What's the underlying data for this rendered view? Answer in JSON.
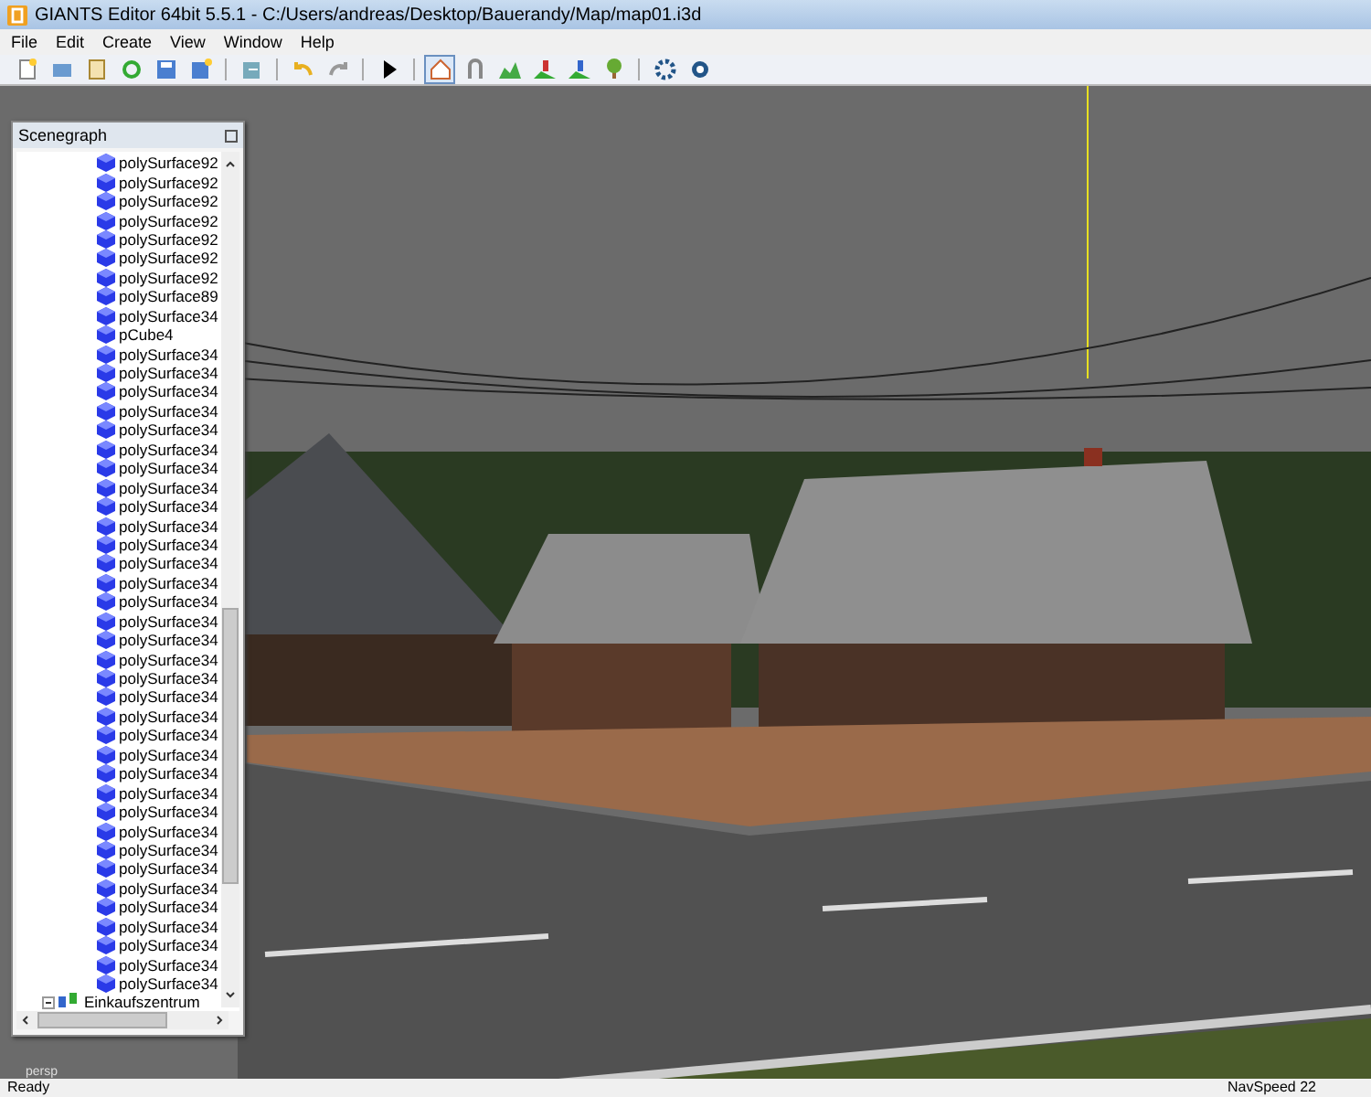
{
  "window": {
    "title": "GIANTS Editor 64bit 5.5.1 - C:/Users/andreas/Desktop/Bauerandy/Map/map01.i3d"
  },
  "menu": [
    "File",
    "Edit",
    "Create",
    "View",
    "Window",
    "Help"
  ],
  "toolbar": [
    {
      "selected": false
    },
    {
      "selected": false
    },
    {
      "selected": false
    },
    {
      "selected": false
    },
    {
      "selected": false
    },
    {
      "selected": false
    },
    {
      "selected": false
    },
    {
      "selected": false
    },
    {
      "selected": false
    },
    {
      "selected": false
    },
    {
      "selected": true
    },
    {
      "selected": false
    },
    {
      "selected": false
    },
    {
      "selected": false
    },
    {
      "selected": false
    },
    {
      "selected": false
    },
    {
      "selected": false
    },
    {
      "selected": false
    }
  ],
  "scenegraph": {
    "title": "Scenegraph",
    "items": [
      {
        "label": "polySurface92",
        "kind": "shape"
      },
      {
        "label": "polySurface92",
        "kind": "shape"
      },
      {
        "label": "polySurface92",
        "kind": "shape"
      },
      {
        "label": "polySurface92",
        "kind": "shape"
      },
      {
        "label": "polySurface92",
        "kind": "shape"
      },
      {
        "label": "polySurface92",
        "kind": "shape"
      },
      {
        "label": "polySurface92",
        "kind": "shape"
      },
      {
        "label": "polySurface89",
        "kind": "shape"
      },
      {
        "label": "polySurface34",
        "kind": "shape"
      },
      {
        "label": "pCube4",
        "kind": "shape"
      },
      {
        "label": "polySurface34",
        "kind": "shape"
      },
      {
        "label": "polySurface34",
        "kind": "shape"
      },
      {
        "label": "polySurface34",
        "kind": "shape"
      },
      {
        "label": "polySurface34",
        "kind": "shape"
      },
      {
        "label": "polySurface34",
        "kind": "shape"
      },
      {
        "label": "polySurface34",
        "kind": "shape"
      },
      {
        "label": "polySurface34",
        "kind": "shape"
      },
      {
        "label": "polySurface34",
        "kind": "shape"
      },
      {
        "label": "polySurface34",
        "kind": "shape"
      },
      {
        "label": "polySurface34",
        "kind": "shape"
      },
      {
        "label": "polySurface34",
        "kind": "shape"
      },
      {
        "label": "polySurface34",
        "kind": "shape"
      },
      {
        "label": "polySurface34",
        "kind": "shape"
      },
      {
        "label": "polySurface34",
        "kind": "shape"
      },
      {
        "label": "polySurface34",
        "kind": "shape"
      },
      {
        "label": "polySurface34",
        "kind": "shape"
      },
      {
        "label": "polySurface34",
        "kind": "shape"
      },
      {
        "label": "polySurface34",
        "kind": "shape"
      },
      {
        "label": "polySurface34",
        "kind": "shape"
      },
      {
        "label": "polySurface34",
        "kind": "shape"
      },
      {
        "label": "polySurface34",
        "kind": "shape"
      },
      {
        "label": "polySurface34",
        "kind": "shape"
      },
      {
        "label": "polySurface34",
        "kind": "shape"
      },
      {
        "label": "polySurface34",
        "kind": "shape"
      },
      {
        "label": "polySurface34",
        "kind": "shape"
      },
      {
        "label": "polySurface34",
        "kind": "shape"
      },
      {
        "label": "polySurface34",
        "kind": "shape"
      },
      {
        "label": "polySurface34",
        "kind": "shape"
      },
      {
        "label": "polySurface34",
        "kind": "shape"
      },
      {
        "label": "polySurface34",
        "kind": "shape"
      },
      {
        "label": "polySurface34",
        "kind": "shape"
      },
      {
        "label": "polySurface34",
        "kind": "shape"
      },
      {
        "label": "polySurface34",
        "kind": "shape"
      },
      {
        "label": "polySurface34",
        "kind": "shape"
      },
      {
        "label": "Einkaufszentrum",
        "kind": "group"
      }
    ]
  },
  "viewport": {
    "camera": "persp"
  },
  "status_bar": {
    "left": "Ready",
    "right": "NavSpeed 22"
  }
}
